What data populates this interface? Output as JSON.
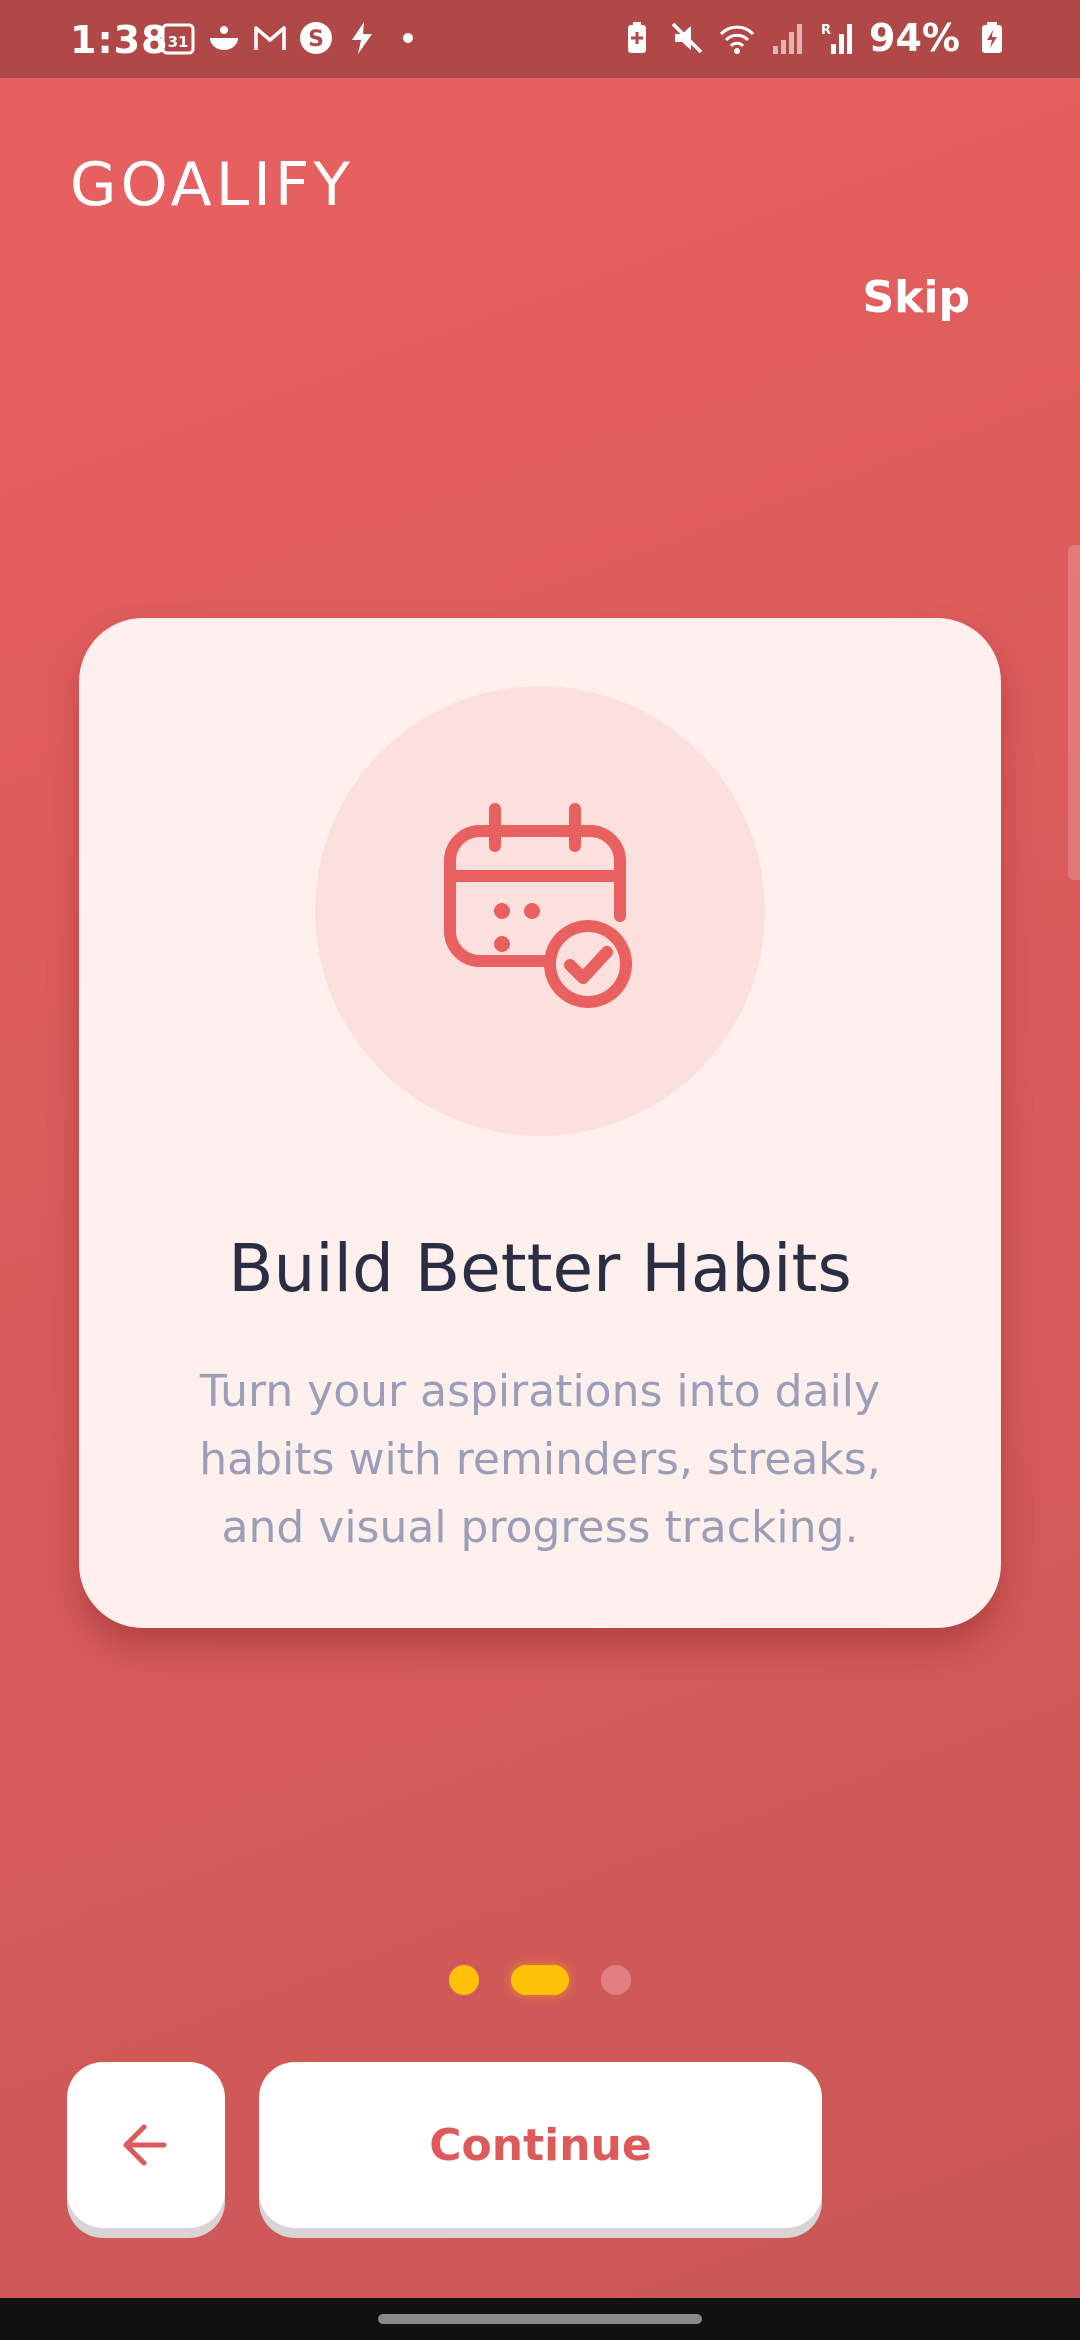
{
  "status_bar": {
    "time": "1:38",
    "battery_percent": "94%",
    "left_icons": [
      "calendar-icon",
      "food-icon",
      "gmail-icon",
      "s-app-icon",
      "bolt-icon",
      "dot-icon"
    ],
    "right_icons": [
      "battery-saver-icon",
      "mute-icon",
      "wifi-icon",
      "signal-icon",
      "signal-r-icon",
      "battery-icon"
    ],
    "calendar_day": "31"
  },
  "header": {
    "app_title": "GOALIFY",
    "skip_label": "Skip"
  },
  "card": {
    "icon": "calendar-check-icon",
    "title": "Build Better Habits",
    "description": "Turn your aspirations into daily habits with reminders, streaks, and visual progress tracking."
  },
  "pager": {
    "total_pages": 3,
    "current_page": 2
  },
  "footer": {
    "back_icon": "arrow-left-icon",
    "continue_label": "Continue"
  },
  "colors": {
    "background": "#dc5b5b",
    "status_bar": "#b04848",
    "card_bg": "#fff0ee",
    "accent": "#e86160",
    "dot_active": "#ffc107",
    "title_text": "#2a2e42",
    "desc_text": "#9a9eb8"
  }
}
